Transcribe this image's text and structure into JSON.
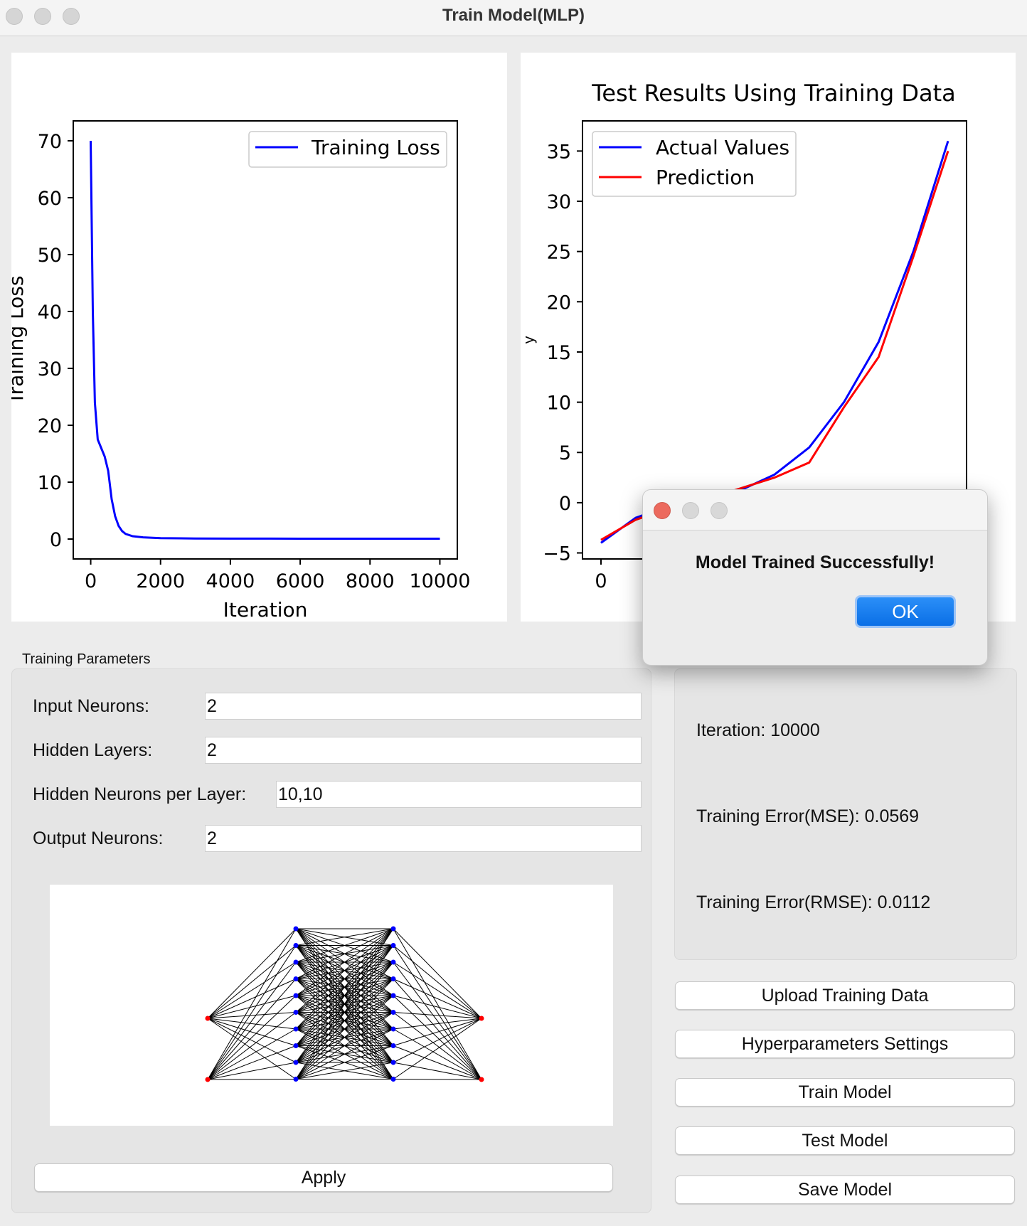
{
  "window": {
    "title": "Train Model(MLP)"
  },
  "loss_chart": {
    "ylabel": "Training Loss",
    "xlabel": "Iteration",
    "xticks": [
      "0",
      "2000",
      "4000",
      "6000",
      "8000",
      "10000"
    ],
    "yticks": [
      "0",
      "10",
      "20",
      "30",
      "40",
      "50",
      "60",
      "70"
    ],
    "legend": [
      "Training Loss"
    ]
  },
  "test_chart": {
    "title": "Test Results Using Training Data",
    "ylabel": "y",
    "xticks": [
      "0"
    ],
    "yticks": [
      "−5",
      "0",
      "5",
      "10",
      "15",
      "20",
      "25",
      "30",
      "35"
    ],
    "legend": [
      "Actual Values",
      "Prediction"
    ]
  },
  "chart_data": [
    {
      "type": "line",
      "title": "",
      "xlabel": "Iteration",
      "ylabel": "Training Loss",
      "xlim": [
        -500,
        10500
      ],
      "ylim": [
        -3.5,
        73.5
      ],
      "grid": false,
      "legend_position": "top-right",
      "series": [
        {
          "name": "Training Loss",
          "color": "#0000ff",
          "x": [
            0,
            60,
            120,
            200,
            300,
            400,
            500,
            600,
            700,
            800,
            900,
            1000,
            1200,
            1500,
            2000,
            3000,
            4000,
            5000,
            6000,
            7000,
            8000,
            9000,
            10000
          ],
          "y": [
            70,
            40,
            24,
            17.5,
            16,
            14.5,
            12,
            7,
            4,
            2.3,
            1.4,
            0.9,
            0.5,
            0.3,
            0.15,
            0.1,
            0.08,
            0.07,
            0.06,
            0.06,
            0.06,
            0.06,
            0.06
          ]
        }
      ]
    },
    {
      "type": "line",
      "title": "Test Results Using Training Data",
      "xlabel": "",
      "ylabel": "y",
      "ylim": [
        -5.6,
        38
      ],
      "grid": false,
      "legend_position": "top-left",
      "series": [
        {
          "name": "Actual Values",
          "color": "#0000ff",
          "x": [
            0,
            1,
            2,
            3,
            4,
            5,
            6,
            7,
            8,
            9,
            10
          ],
          "y": [
            -4,
            -1.5,
            -0.3,
            0.2,
            1.2,
            2.8,
            5.5,
            10,
            16,
            25,
            36
          ]
        },
        {
          "name": "Prediction",
          "color": "#ff0000",
          "x": [
            0,
            1,
            2,
            3,
            4,
            5,
            6,
            7,
            8,
            9,
            10
          ],
          "y": [
            -3.7,
            -1.7,
            -0.5,
            0.3,
            1.4,
            2.5,
            4,
            9.5,
            14.5,
            24.5,
            35
          ]
        }
      ]
    }
  ],
  "params": {
    "group_label": "Training Parameters",
    "input_neurons_label": "Input Neurons:",
    "input_neurons_value": "2",
    "hidden_layers_label": "Hidden Layers:",
    "hidden_layers_value": "2",
    "hidden_neurons_label": "Hidden Neurons per Layer:",
    "hidden_neurons_value": "10,10",
    "output_neurons_label": "Output Neurons:",
    "output_neurons_value": "2",
    "apply_label": "Apply"
  },
  "network": {
    "layers": [
      2,
      10,
      10,
      2
    ],
    "io_color": "#ff0000",
    "hidden_color": "#0000ff",
    "edge_color": "#000000"
  },
  "info": {
    "iteration": "Iteration: 10000",
    "mse": "Training Error(MSE): 0.0569",
    "rmse": "Training Error(RMSE): 0.0112"
  },
  "actions": {
    "upload": "Upload Training Data",
    "hyper": "Hyperparameters Settings",
    "train": "Train Model",
    "test": "Test Model",
    "save": "Save Model"
  },
  "dialog": {
    "message": "Model Trained Successfully!",
    "ok_label": "OK",
    "close_color": "#ec6a5e"
  }
}
